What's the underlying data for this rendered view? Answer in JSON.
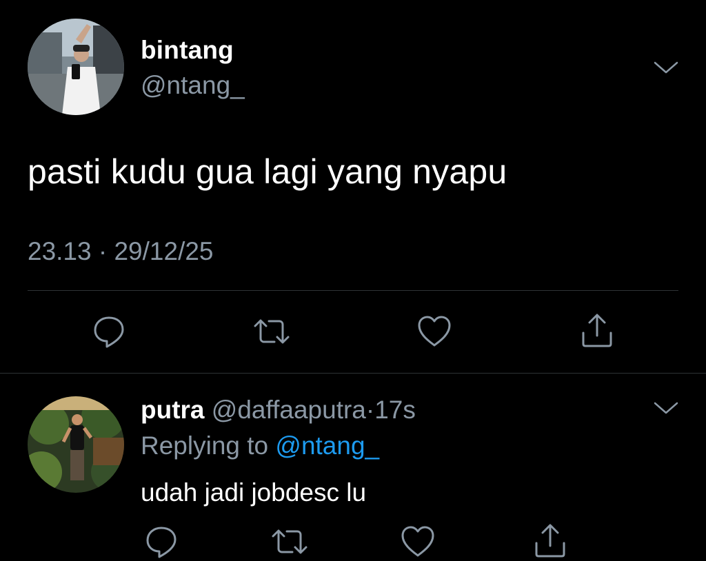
{
  "tweet": {
    "author": {
      "display_name": "bintang",
      "handle": "@ntang_"
    },
    "text": "pasti kudu gua lagi yang nyapu",
    "time": "23.13",
    "separator": "·",
    "date": "29/12/25",
    "actions": [
      "reply-icon",
      "retweet-icon",
      "like-icon",
      "share-icon"
    ]
  },
  "reply": {
    "author": {
      "display_name": "putra",
      "handle": "@daffaaputra"
    },
    "separator": "·",
    "age": "17s",
    "replying_prefix": "Replying to",
    "replying_handle": "@ntang_",
    "text": "udah jadi jobdesc lu",
    "actions": [
      "reply-icon",
      "retweet-icon",
      "like-icon",
      "share-icon"
    ]
  },
  "colors": {
    "background": "#000000",
    "primary_text": "#ffffff",
    "secondary_text": "#8b98a5",
    "mention": "#1d9bf0",
    "divider": "#2f3336"
  }
}
